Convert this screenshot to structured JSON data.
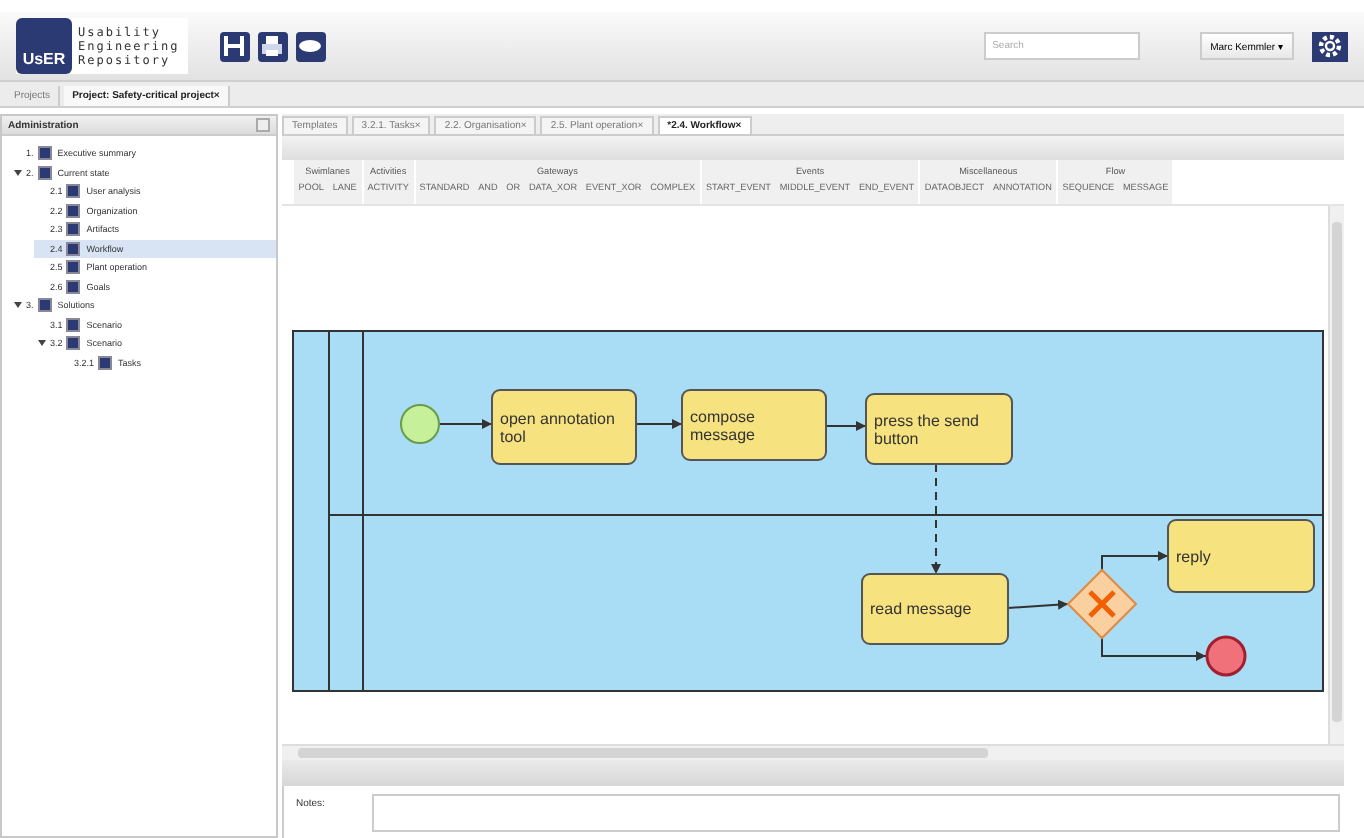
{
  "header": {
    "logo_badge": "UsER",
    "logo_lines": [
      "Usability",
      "Engineering",
      "Repository"
    ],
    "search": {
      "placeholder": "Search"
    },
    "user_menu": "Marc Kemmler ▾"
  },
  "project_tabs": [
    {
      "label": "Projects",
      "selected": false
    },
    {
      "label": "Project: Safety-critical project",
      "selected": true,
      "close": "×"
    }
  ],
  "sidebar": {
    "title": "Administration",
    "tree": [
      {
        "number": "1.",
        "label": "Executive summary",
        "selected": false
      },
      {
        "number": "2.",
        "label": "Current state",
        "selected": false,
        "expanded": true,
        "children": [
          {
            "number": "2.1",
            "label": "User analysis",
            "selected": false
          },
          {
            "number": "2.2",
            "label": "Organization",
            "selected": false
          },
          {
            "number": "2.3",
            "label": "Artifacts",
            "selected": false
          },
          {
            "number": "2.4",
            "label": "Workflow",
            "selected": true
          },
          {
            "number": "2.5",
            "label": "Plant operation",
            "selected": false
          },
          {
            "number": "2.6",
            "label": "Goals",
            "selected": false
          }
        ]
      },
      {
        "number": "3.",
        "label": "Solutions",
        "selected": false,
        "expanded": true,
        "children": [
          {
            "number": "3.1",
            "label": "Scenario",
            "selected": false
          },
          {
            "number": "3.2",
            "label": "Scenario",
            "selected": false,
            "expanded": true,
            "children": [
              {
                "number": "3.2.1",
                "label": "Tasks",
                "selected": false
              }
            ]
          }
        ]
      }
    ]
  },
  "editor_tabs": [
    {
      "label": "Templates",
      "selected": false
    },
    {
      "label": "3.2.1. Tasks",
      "selected": false,
      "close": "×"
    },
    {
      "label": "2.2. Organisation",
      "selected": false,
      "close": "×"
    },
    {
      "label": "2.5. Plant operation",
      "selected": false,
      "close": "×"
    },
    {
      "label": "*2.4. Workflow",
      "selected": true,
      "close": "×"
    }
  ],
  "palette": [
    {
      "group": "Swimlanes",
      "items": [
        "POOL",
        "LANE"
      ]
    },
    {
      "group": "Activities",
      "items": [
        "ACTIVITY"
      ]
    },
    {
      "group": "Gateways",
      "items": [
        "STANDARD",
        "AND",
        "OR",
        "DATA_XOR",
        "EVENT_XOR",
        "COMPLEX"
      ]
    },
    {
      "group": "Events",
      "items": [
        "START_EVENT",
        "MIDDLE_EVENT",
        "END_EVENT"
      ]
    },
    {
      "group": "Miscellaneous",
      "items": [
        "DATAOBJECT",
        "ANNOTATION"
      ]
    },
    {
      "group": "Flow",
      "items": [
        "SEQUENCE",
        "MESSAGE"
      ]
    }
  ],
  "diagram": {
    "nodes": [
      {
        "kind": "start"
      },
      {
        "kind": "task",
        "label": "open annotation tool"
      },
      {
        "kind": "task",
        "label": "compose message"
      },
      {
        "kind": "task",
        "label": "press the send button"
      },
      {
        "kind": "task",
        "label": "read message"
      },
      {
        "kind": "gateway"
      },
      {
        "kind": "task",
        "label": "reply"
      },
      {
        "kind": "end"
      }
    ],
    "edges": [
      {
        "kind": "sequence"
      },
      {
        "kind": "sequence"
      },
      {
        "kind": "sequence"
      },
      {
        "kind": "message"
      },
      {
        "kind": "sequence"
      },
      {
        "kind": "sequence"
      },
      {
        "kind": "sequence"
      }
    ]
  },
  "notes": {
    "label": "Notes:"
  }
}
